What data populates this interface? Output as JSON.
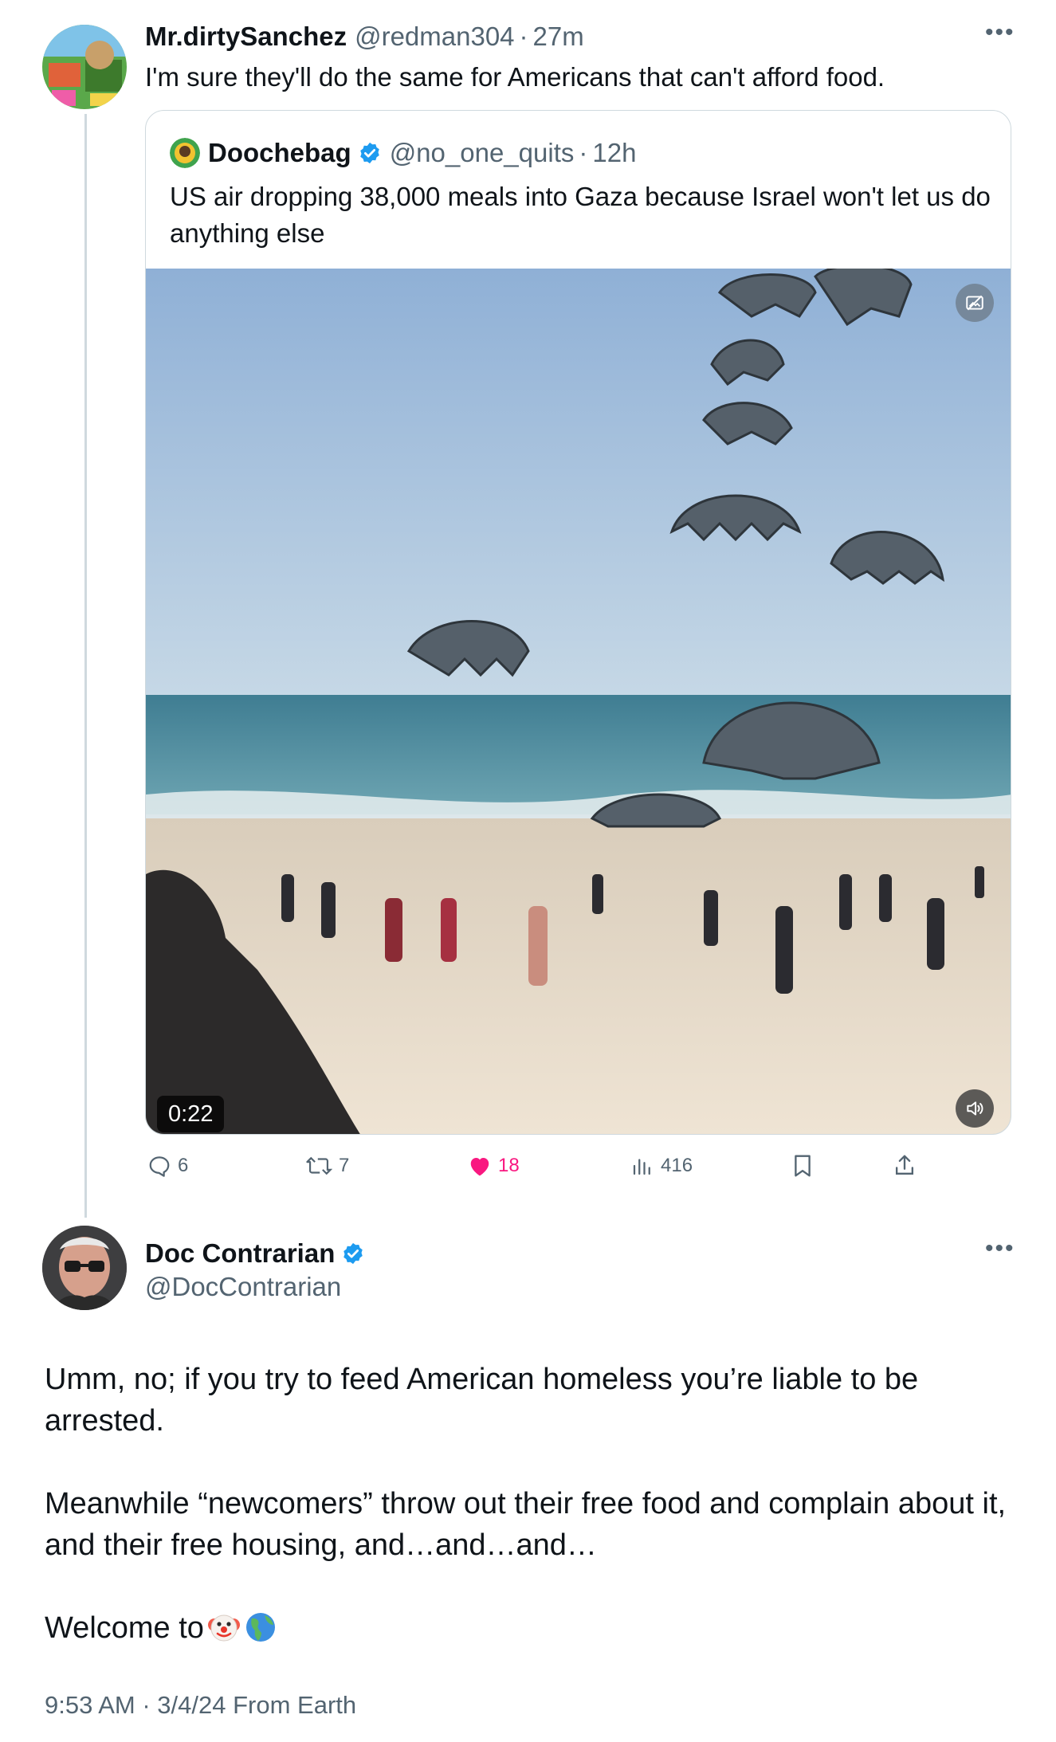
{
  "thread": {
    "reply_author": {
      "display_name": "Mr.dirtySanchez",
      "handle": "@redman304",
      "time": "27m",
      "more_icon": "ellipsis-icon",
      "text": "I'm sure they'll do the same for Americans that can't afford food."
    },
    "quoted_tweet": {
      "display_name": "Doochebag",
      "verified_icon": "verified-badge-icon",
      "handle": "@no_one_quits",
      "time": "12h",
      "text": "US air dropping 38,000 meals into Gaza because Israel won't let us do anything else",
      "video": {
        "duration": "0:22",
        "top_icon": "hide-media-icon",
        "volume_icon": "volume-icon"
      }
    },
    "actions": {
      "replies": "6",
      "reposts": "7",
      "likes": "18",
      "views": "416",
      "bookmark_icon": "bookmark-icon",
      "share_icon": "share-icon"
    }
  },
  "main_tweet": {
    "display_name": "Doc Contrarian",
    "verified_icon": "verified-badge-icon",
    "handle": "@DocContrarian",
    "more_icon": "ellipsis-icon",
    "paragraphs": [
      "Umm, no; if you try to feed American homeless you’re liable to be arrested.",
      "Meanwhile “newcomers” throw out their free food and complain about it, and their free housing, and…and…and…",
      "Welcome to"
    ],
    "emojis": [
      "clown-face-emoji",
      "globe-americas-emoji"
    ],
    "timestamp": "9:53 AM · 3/4/24 From Earth"
  },
  "colors": {
    "text": "#0f1419",
    "muted": "#536471",
    "verified": "#1d9bf0",
    "like": "#f91880",
    "border": "#cfd9de"
  }
}
